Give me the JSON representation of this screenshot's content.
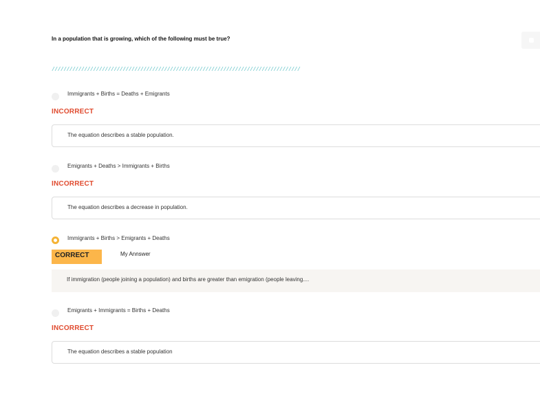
{
  "question": "In a population that is growing, which of the following must be true?",
  "divider": "////////////////////////////////////////////////////////////////////////////////////",
  "options": [
    {
      "text": "Immigrants + Births = Deaths + Emigrants",
      "status": "INCORRECT",
      "feedback": "The equation describes a stable population.",
      "selected": false
    },
    {
      "text": "Emigrants + Deaths > Immigrants + Births",
      "status": "INCORRECT",
      "feedback": "The equation describes a decrease in population.",
      "selected": false
    },
    {
      "text": "Immigrants + Births > Emigrants + Deaths",
      "status": "CORRECT",
      "answer_label": "My Annswer",
      "feedback": "If immigration (people joining a population) and births are greater than emigration (people leaving....",
      "selected": true
    },
    {
      "text": "Emigrants + Immigrants =  Births + Deaths",
      "status": "INCORRECT",
      "feedback": "The equation describes a stable population",
      "selected": false
    }
  ],
  "colors": {
    "incorrect": "#e04b2f",
    "correct_badge": "#fcb64a",
    "selected_radio": "#f5b335",
    "divider": "#5bc0c4"
  }
}
